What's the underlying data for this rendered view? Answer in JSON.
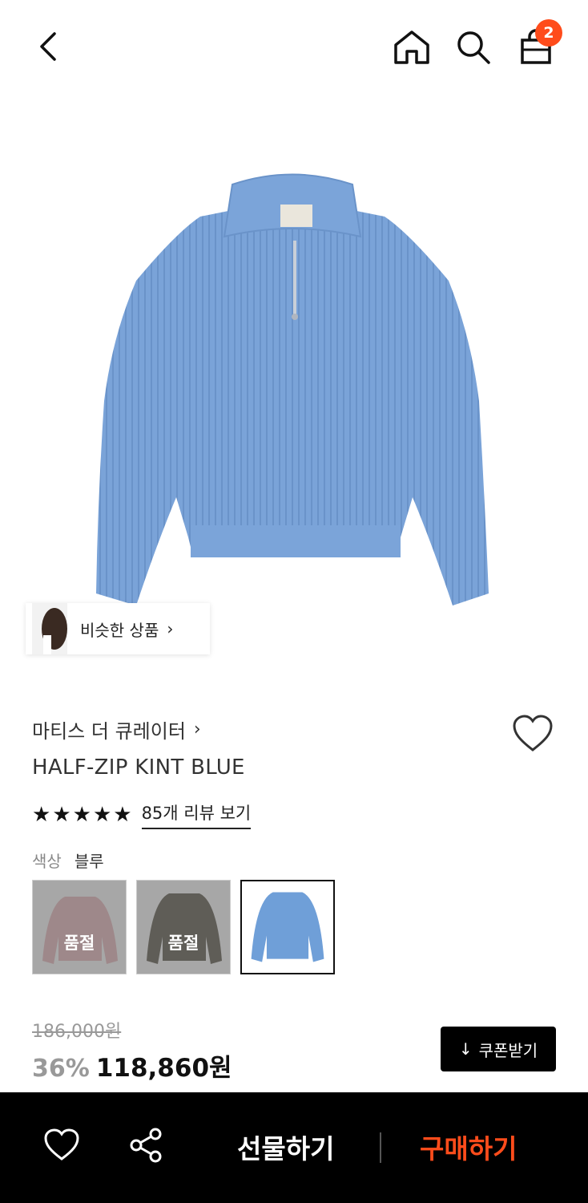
{
  "header": {
    "cart_count": "2"
  },
  "similar": {
    "label": "비슷한 상품",
    "chevron": "›"
  },
  "product": {
    "brand": "마티스 더 큐레이터",
    "brand_chevron": "›",
    "name": "HALF-ZIP KINT BLUE",
    "stars": [
      "★",
      "★",
      "★",
      "★",
      "★"
    ],
    "review_link": "85개 리뷰 보기",
    "color_label": "색상",
    "color_value": "블루",
    "swatches": [
      {
        "color": "#d9a9ad",
        "status": "품절"
      },
      {
        "color": "#4f4a3d",
        "status": "품절"
      },
      {
        "color": "#6f9fd8",
        "status": ""
      }
    ],
    "original_price": "186,000원",
    "discount": "36%",
    "sale_price": "118,860원",
    "coupon_label": "쿠폰받기",
    "coupon_icon": "↓"
  },
  "bottom_bar": {
    "gift_label": "선물하기",
    "buy_label": "구매하기"
  },
  "colors": {
    "accent": "#ff4c1b",
    "sweater": "#7aa3d8"
  }
}
